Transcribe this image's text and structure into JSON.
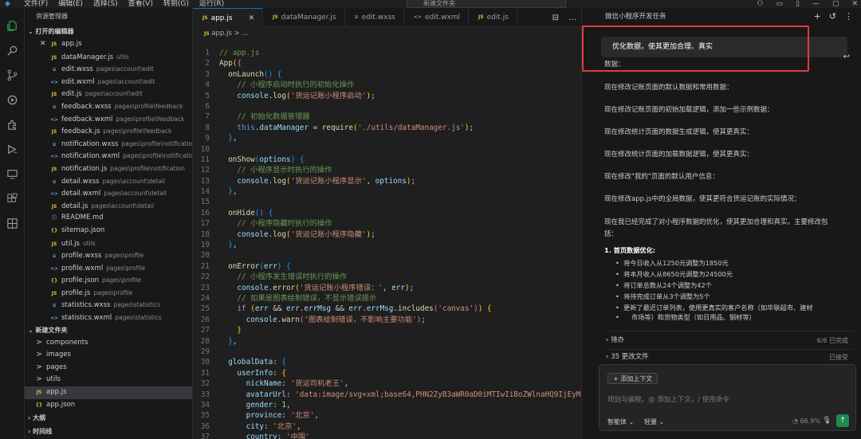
{
  "titlebar": {
    "menu": [
      "文件(F)",
      "编辑(E)",
      "选择(S)",
      "查看(V)",
      "转到(G)",
      "运行(R)"
    ],
    "search_placeholder": "新建文件夹"
  },
  "sidebar": {
    "header": "资源管理器",
    "open_editors_label": "打开的编辑器",
    "open_editors": [
      {
        "icon": "JS",
        "type": "js",
        "name": "app.js",
        "path": "",
        "close": true
      },
      {
        "icon": "JS",
        "type": "js",
        "name": "dataManager.js",
        "path": "utils"
      },
      {
        "icon": "≡",
        "type": "wx",
        "name": "edit.wxss",
        "path": "pages\\account\\edit"
      },
      {
        "icon": "<>",
        "type": "wx",
        "name": "edit.wxml",
        "path": "pages\\account\\edit"
      },
      {
        "icon": "JS",
        "type": "js",
        "name": "edit.js",
        "path": "pages\\account\\edit"
      },
      {
        "icon": "≡",
        "type": "wx",
        "name": "feedback.wxss",
        "path": "pages\\profile\\feedback"
      },
      {
        "icon": "<>",
        "type": "wx",
        "name": "feedback.wxml",
        "path": "pages\\profile\\feedback"
      },
      {
        "icon": "JS",
        "type": "js",
        "name": "feedback.js",
        "path": "pages\\profile\\feedback"
      },
      {
        "icon": "≡",
        "type": "wx",
        "name": "notification.wxss",
        "path": "pages\\profile\\notification"
      },
      {
        "icon": "<>",
        "type": "wx",
        "name": "notification.wxml",
        "path": "pages\\profile\\notification"
      },
      {
        "icon": "JS",
        "type": "js",
        "name": "notification.js",
        "path": "pages\\profile\\notification"
      },
      {
        "icon": "≡",
        "type": "wx",
        "name": "detail.wxss",
        "path": "pages\\account\\detail"
      },
      {
        "icon": "<>",
        "type": "wx",
        "name": "detail.wxml",
        "path": "pages\\account\\detail"
      },
      {
        "icon": "JS",
        "type": "js",
        "name": "detail.js",
        "path": "pages\\account\\detail"
      },
      {
        "icon": "ⓘ",
        "type": "md",
        "name": "README.md",
        "path": ""
      },
      {
        "icon": "{}",
        "type": "json",
        "name": "sitemap.json",
        "path": ""
      },
      {
        "icon": "JS",
        "type": "js",
        "name": "util.js",
        "path": "utils"
      },
      {
        "icon": "≡",
        "type": "wx",
        "name": "profile.wxss",
        "path": "pages\\profile"
      },
      {
        "icon": "<>",
        "type": "wx",
        "name": "profile.wxml",
        "path": "pages\\profile"
      },
      {
        "icon": "{}",
        "type": "json",
        "name": "profile.json",
        "path": "pages\\profile"
      },
      {
        "icon": "JS",
        "type": "js",
        "name": "profile.js",
        "path": "pages\\profile"
      },
      {
        "icon": "≡",
        "type": "wx",
        "name": "statistics.wxss",
        "path": "pages\\statistics"
      },
      {
        "icon": "<>",
        "type": "wx",
        "name": "statistics.wxml",
        "path": "pages\\statistics"
      }
    ],
    "folder_label": "新建文件夹",
    "folder_items": [
      {
        "icon": ">",
        "name": "components"
      },
      {
        "icon": ">",
        "name": "images"
      },
      {
        "icon": ">",
        "name": "pages"
      },
      {
        "icon": ">",
        "name": "utils"
      },
      {
        "icon": "JS",
        "name": "app.js"
      },
      {
        "icon": "{}",
        "name": "app.json"
      }
    ],
    "outline_label": "大纲",
    "timeline_label": "时间线"
  },
  "editor": {
    "tabs": [
      {
        "icon": "JS",
        "label": "app.js",
        "active": true
      },
      {
        "icon": "JS",
        "label": "dataManager.js"
      },
      {
        "icon": "≡",
        "label": "edit.wxss"
      },
      {
        "icon": "<>",
        "label": "edit.wxml"
      },
      {
        "icon": "JS",
        "label": "edit.js"
      }
    ],
    "breadcrumb": "app.js > ..."
  },
  "chat": {
    "title": "微信小程序开发任务",
    "prompt": "优化数据，使其更加合理、真实",
    "messages": [
      "数据：",
      "现在修改记账页面的默认数据和常用数据：",
      "现在修改记账页面的初始加载逻辑，添加一些示例数据：",
      "现在修改统计页面的数据生成逻辑，使其更真实：",
      "现在修改统计页面的加载数据逻辑，使其更真实：",
      "现在修改\"我的\"页面的默认用户信息：",
      "现在修改app.js中的全局数据，使其更符合货运记账的实际情况：",
      "现在我已经完成了对小程序数据的优化，使其更加合理和真实。主要修改包",
      "括："
    ],
    "summary_title": "1. 首页数据优化:",
    "summary_items": [
      "将今日收入从1250元调整为1850元",
      "将本月收入从8650元调整为24500元",
      "将订单总数从24个调整为42个",
      "将待完成订单从3个调整为5个",
      "更新了最近订单列表，使用更真实的客户名称（如华联超市、建材",
      "市场等）和货物类型（如日用品、钢材等）"
    ],
    "pending": {
      "label": "待办",
      "status": "6/6 已完成"
    },
    "changes": {
      "label": "35 更改文件",
      "status": "已接受"
    },
    "composer": {
      "context_button": "添加上下文",
      "placeholder": "规划与编程，@ 添加上下文，/ 使用命令",
      "mode": "智能体",
      "model": "轻量",
      "usage": "66.9%"
    }
  }
}
